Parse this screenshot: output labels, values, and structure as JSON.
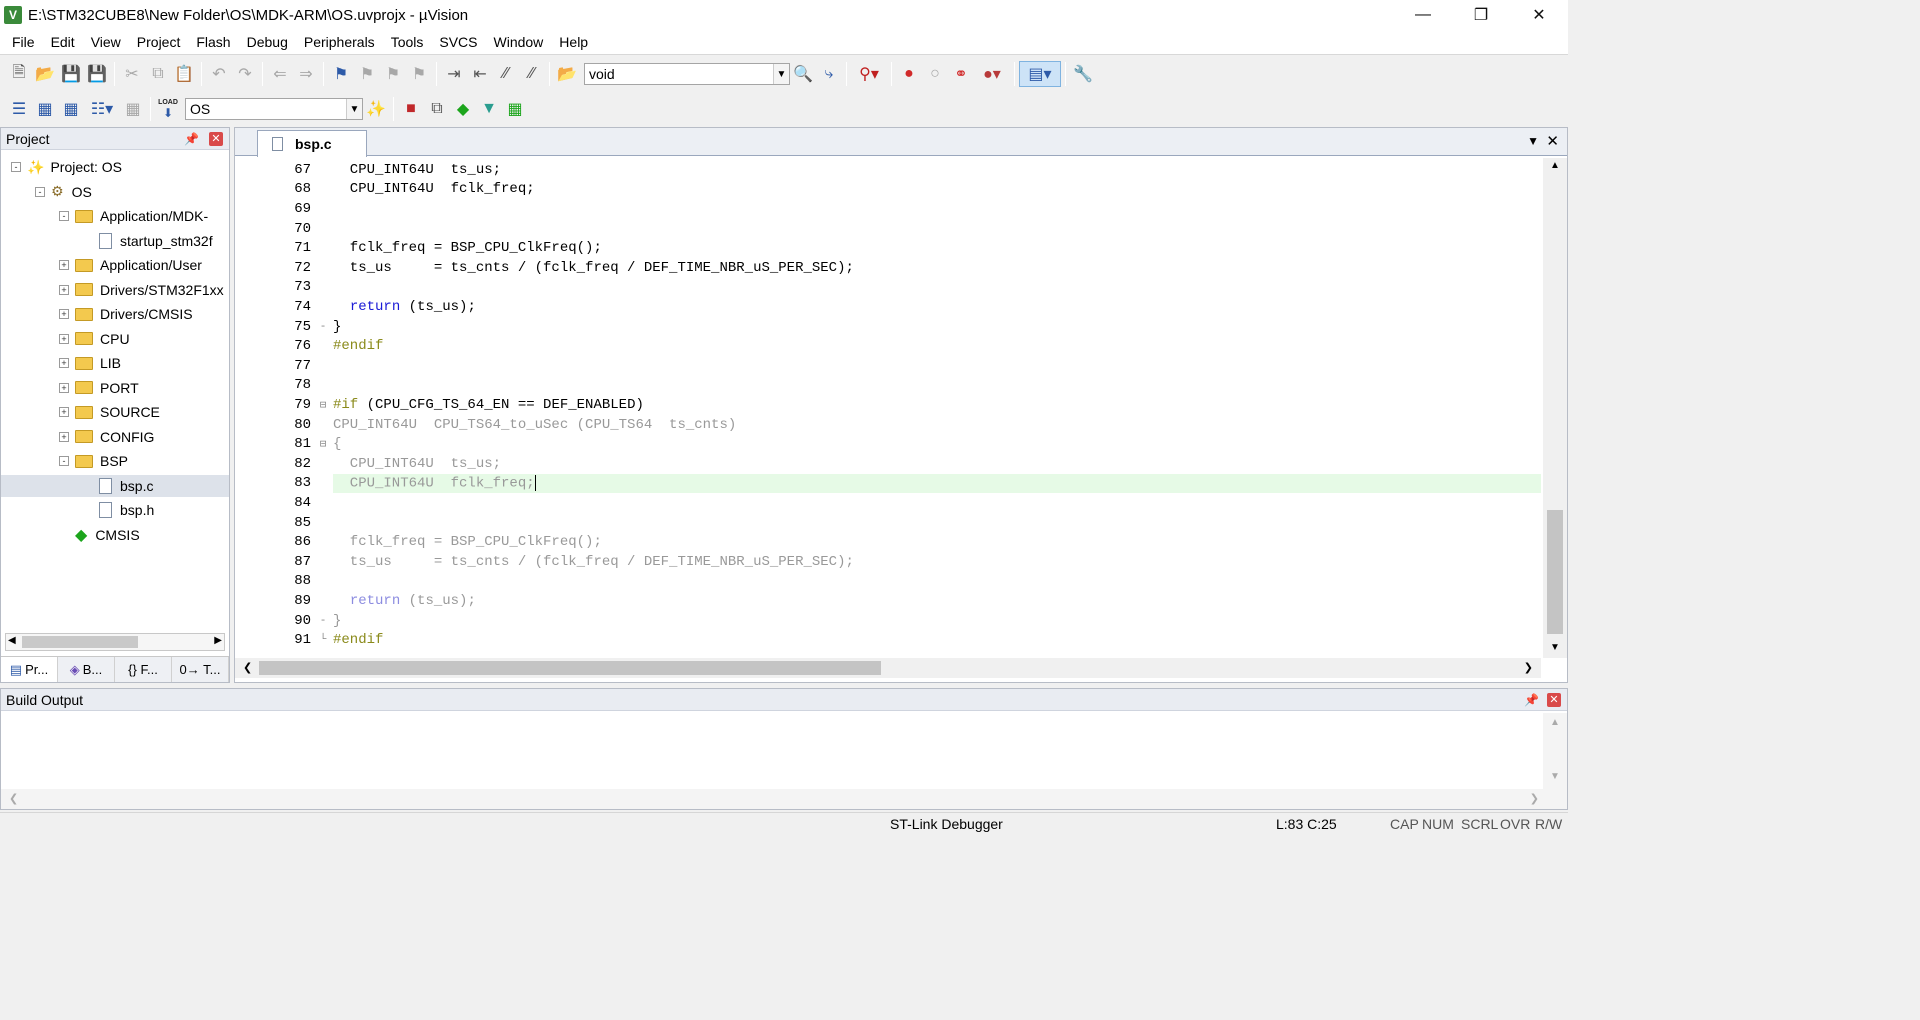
{
  "window": {
    "title": "E:\\STM32CUBE8\\New Folder\\OS\\MDK-ARM\\OS.uvprojx - µVision",
    "app_icon": "V"
  },
  "menu": [
    "File",
    "Edit",
    "View",
    "Project",
    "Flash",
    "Debug",
    "Peripherals",
    "Tools",
    "SVCS",
    "Window",
    "Help"
  ],
  "toolbar1": {
    "find_combo_value": "void"
  },
  "toolbar2": {
    "target_combo_value": "OS",
    "load_label": "LOAD"
  },
  "project_panel": {
    "title": "Project",
    "tree": [
      {
        "label": "Project: OS",
        "level": 0,
        "type": "project",
        "expand": "-"
      },
      {
        "label": "OS",
        "level": 1,
        "type": "target",
        "expand": "-"
      },
      {
        "label": "Application/MDK-",
        "level": 2,
        "type": "folder",
        "expand": "-"
      },
      {
        "label": "startup_stm32f",
        "level": 3,
        "type": "file",
        "expand": ""
      },
      {
        "label": "Application/User",
        "level": 2,
        "type": "folder",
        "expand": "+"
      },
      {
        "label": "Drivers/STM32F1xx",
        "level": 2,
        "type": "folder",
        "expand": "+"
      },
      {
        "label": "Drivers/CMSIS",
        "level": 2,
        "type": "folder",
        "expand": "+"
      },
      {
        "label": "CPU",
        "level": 2,
        "type": "folder",
        "expand": "+"
      },
      {
        "label": "LIB",
        "level": 2,
        "type": "folder",
        "expand": "+"
      },
      {
        "label": "PORT",
        "level": 2,
        "type": "folder",
        "expand": "+"
      },
      {
        "label": "SOURCE",
        "level": 2,
        "type": "folder",
        "expand": "+"
      },
      {
        "label": "CONFIG",
        "level": 2,
        "type": "folder",
        "expand": "+"
      },
      {
        "label": "BSP",
        "level": 2,
        "type": "folder",
        "expand": "-"
      },
      {
        "label": "bsp.c",
        "level": 3,
        "type": "file",
        "expand": "",
        "selected": true
      },
      {
        "label": "bsp.h",
        "level": 3,
        "type": "file",
        "expand": ""
      },
      {
        "label": "CMSIS",
        "level": 2,
        "type": "component",
        "expand": ""
      }
    ],
    "tabs": [
      "Pr...",
      "B...",
      "{} F...",
      "0→ T..."
    ]
  },
  "editor": {
    "tab": "bsp.c",
    "highlight_line": 83,
    "lines": [
      {
        "n": "67",
        "t": "  CPU_INT64U  ts_us;",
        "f": "",
        "c": "#000"
      },
      {
        "n": "68",
        "t": "  CPU_INT64U  fclk_freq;",
        "f": "",
        "c": "#000"
      },
      {
        "n": "69",
        "t": "",
        "f": "",
        "c": "#000"
      },
      {
        "n": "70",
        "t": "",
        "f": "",
        "c": "#000"
      },
      {
        "n": "71",
        "t": "  fclk_freq = BSP_CPU_ClkFreq();",
        "f": "",
        "c": "#000"
      },
      {
        "n": "72",
        "t": "  ts_us     = ts_cnts / (fclk_freq / DEF_TIME_NBR_uS_PER_SEC);",
        "f": "",
        "c": "#000"
      },
      {
        "n": "73",
        "t": "",
        "f": "",
        "c": "#000"
      },
      {
        "n": "74",
        "t": "  return (ts_us);",
        "f": "",
        "c": "#000",
        "kw": "return"
      },
      {
        "n": "75",
        "t": "}",
        "f": "-",
        "c": "#000"
      },
      {
        "n": "76",
        "t": "#endif",
        "f": "",
        "c": "#8a8a1a"
      },
      {
        "n": "77",
        "t": "",
        "f": "",
        "c": "#000"
      },
      {
        "n": "78",
        "t": "",
        "f": "",
        "c": "#000"
      },
      {
        "n": "79",
        "t": "#if (CPU_CFG_TS_64_EN == DEF_ENABLED)",
        "f": "⊟",
        "c": "#000",
        "pp": true
      },
      {
        "n": "80",
        "t": "CPU_INT64U  CPU_TS64_to_uSec (CPU_TS64  ts_cnts)",
        "f": "",
        "c": "#999"
      },
      {
        "n": "81",
        "t": "{",
        "f": "⊟",
        "c": "#999"
      },
      {
        "n": "82",
        "t": "  CPU_INT64U  ts_us;",
        "f": "",
        "c": "#999"
      },
      {
        "n": "83",
        "t": "  CPU_INT64U  fclk_freq;",
        "f": "",
        "c": "#999"
      },
      {
        "n": "84",
        "t": "",
        "f": "",
        "c": "#999"
      },
      {
        "n": "85",
        "t": "",
        "f": "",
        "c": "#999"
      },
      {
        "n": "86",
        "t": "  fclk_freq = BSP_CPU_ClkFreq();",
        "f": "",
        "c": "#999"
      },
      {
        "n": "87",
        "t": "  ts_us     = ts_cnts / (fclk_freq / DEF_TIME_NBR_uS_PER_SEC);",
        "f": "",
        "c": "#999"
      },
      {
        "n": "88",
        "t": "",
        "f": "",
        "c": "#999"
      },
      {
        "n": "89",
        "t": "  return (ts_us);",
        "f": "",
        "c": "#999",
        "kw": "return"
      },
      {
        "n": "90",
        "t": "}",
        "f": "-",
        "c": "#999"
      },
      {
        "n": "91",
        "t": "#endif",
        "f": "└",
        "c": "#8a8a1a"
      }
    ]
  },
  "build_output": {
    "title": "Build Output"
  },
  "status": {
    "debugger": "ST-Link Debugger",
    "position": "L:83 C:25",
    "caps": "CAP",
    "num": "NUM",
    "scrl": "SCRL",
    "ovr": "OVR",
    "rw": "R/W"
  }
}
